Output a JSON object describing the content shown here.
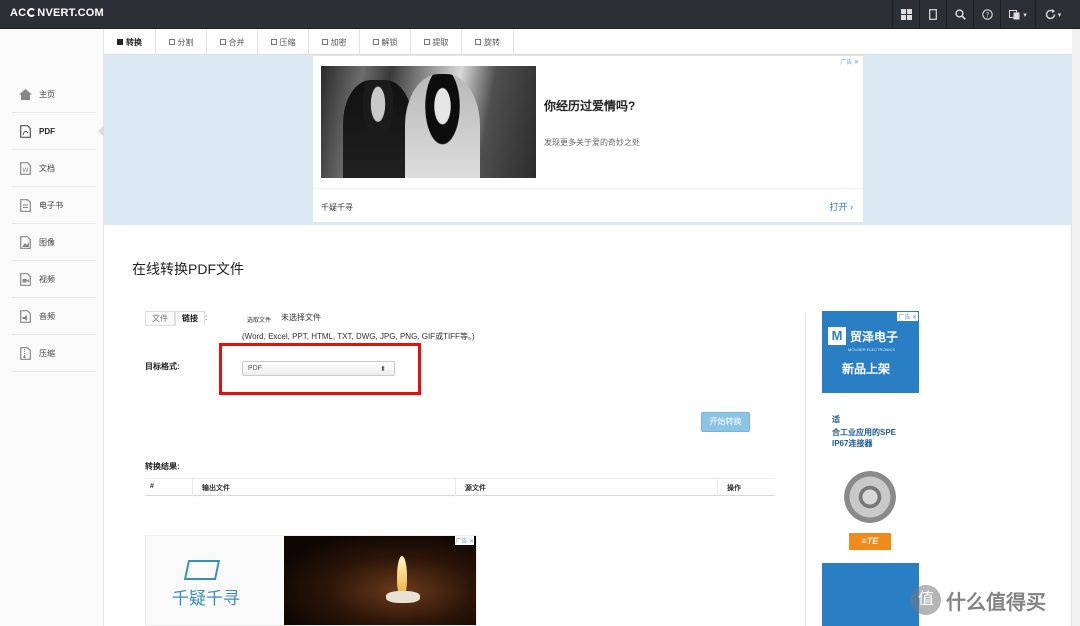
{
  "app": {
    "logo": "AC⟳NVERT.COM",
    "logo_left": "AC",
    "logo_right": "NVERT.COM"
  },
  "topbar": {
    "icons": [
      "grid-icon",
      "tablet-icon",
      "search-icon",
      "help-icon",
      "language-icon",
      "refresh-icon"
    ],
    "dropdown_caret": "▾"
  },
  "sidebar": {
    "items": [
      {
        "label": "主页",
        "icon": "home-icon"
      },
      {
        "label": "PDF",
        "icon": "pdf-icon"
      },
      {
        "label": "文档",
        "icon": "word-doc-icon"
      },
      {
        "label": "电子书",
        "icon": "ebook-icon"
      },
      {
        "label": "图像",
        "icon": "image-icon"
      },
      {
        "label": "视频",
        "icon": "video-icon"
      },
      {
        "label": "音频",
        "icon": "audio-icon"
      },
      {
        "label": "压缩",
        "icon": "archive-icon"
      }
    ]
  },
  "tabs": [
    "转换",
    "分割",
    "合并",
    "压缩",
    "加密",
    "解锁",
    "提取",
    "旋转"
  ],
  "top_ad": {
    "headline": "你经历过爱情吗?",
    "subtitle": "发现更多关于爱的奇妙之处",
    "brand": "千疑千寻",
    "open_label": "打开 ›",
    "tag": "广告 ✕"
  },
  "main": {
    "title": "在线转换PDF文件",
    "source_tabs": [
      "文件",
      "链接"
    ],
    "colon": ":",
    "choose_file_label": "选取文件",
    "no_file_label": "未选择文件",
    "supported_formats": "(Word, Excel, PPT, HTML, TXT, DWG, JPG, PNG, GIF或TIFF等。)",
    "target_format_label": "目标格式:",
    "target_format_value": "PDF",
    "start_button": "开始转换",
    "results_label": "转换结果:",
    "table_headers": [
      "#",
      "输出文件",
      "源文件",
      "操作"
    ]
  },
  "bottom_ad": {
    "brand": "千疑千寻",
    "tag": "广告 ✕"
  },
  "right_ad": {
    "logo_letter": "M",
    "brand": "贸泽电子",
    "brand_en": "MOUSER ELECTRONICS",
    "new_arrivals": "新品上架",
    "line1": "适",
    "line2": "合工业应用的SPE",
    "line3": "IP67连接器",
    "te": "≡TE",
    "tag": "广告 ✕"
  },
  "watermark": {
    "symbol": "值",
    "text": "什么值得买"
  },
  "colors": {
    "topbar": "#2b3037",
    "ad_band": "#dbeaf4",
    "highlight": "#e41010",
    "start_button": "#8cc4e6",
    "link": "#2478c9",
    "mouser_blue": "#2a7ec4"
  }
}
